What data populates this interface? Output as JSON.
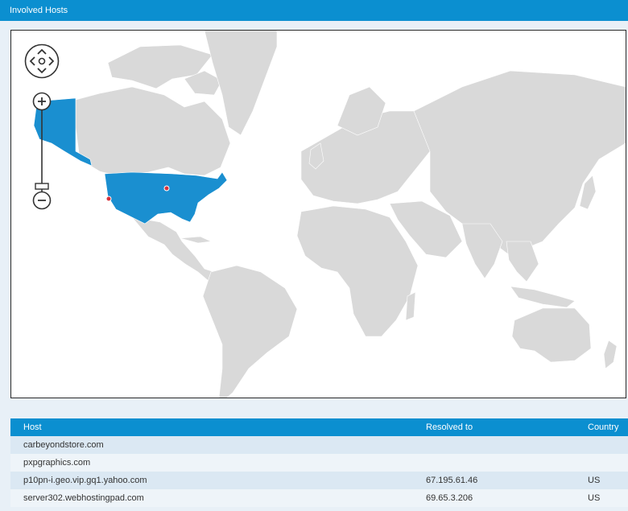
{
  "panel": {
    "title": "Involved Hosts"
  },
  "colors": {
    "accent": "#0b8fd0",
    "highlight_country": "#1a8fd0",
    "land": "#d9d9d9",
    "marker": "#d6323c"
  },
  "map": {
    "highlighted_countries": [
      "United States"
    ],
    "markers": [
      "host-location",
      "host-location"
    ],
    "controls": {
      "pan": "pan-control",
      "zoom_in": "zoom-in",
      "zoom_out": "zoom-out"
    }
  },
  "table": {
    "columns": [
      "Host",
      "Resolved to",
      "Country"
    ],
    "rows": [
      {
        "host": "carbeyondstore.com",
        "resolved": "",
        "country": ""
      },
      {
        "host": "pxpgraphics.com",
        "resolved": "",
        "country": ""
      },
      {
        "host": "p10pn-i.geo.vip.gq1.yahoo.com",
        "resolved": "67.195.61.46",
        "country": "US"
      },
      {
        "host": "server302.webhostingpad.com",
        "resolved": "69.65.3.206",
        "country": "US"
      }
    ]
  }
}
